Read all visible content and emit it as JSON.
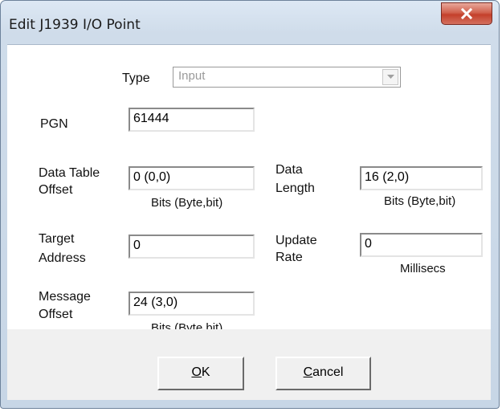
{
  "window": {
    "title": "Edit J1939 I/O Point"
  },
  "icons": {
    "close": "close-icon",
    "dropdown": "chevron-down-icon"
  },
  "form": {
    "type_label": "Type",
    "type_value": "Input",
    "pgn_label": "PGN",
    "pgn_value": "61444",
    "data_table_offset_label_1": "Data Table",
    "data_table_offset_label_2": "Offset",
    "data_table_offset_value": "0 (0,0)",
    "data_table_offset_unit": "Bits (Byte,bit)",
    "data_length_label_1": "Data",
    "data_length_label_2": "Length",
    "data_length_value": "16 (2,0)",
    "data_length_unit": "Bits (Byte,bit)",
    "target_address_label_1": "Target",
    "target_address_label_2": "Address",
    "target_address_value": "0",
    "update_rate_label_1": "Update",
    "update_rate_label_2": "Rate",
    "update_rate_value": "0",
    "update_rate_unit": "Millisecs",
    "message_offset_label_1": "Message",
    "message_offset_label_2": "Offset",
    "message_offset_value": "24 (3,0)",
    "message_offset_unit": "Bits (Byte,bit)"
  },
  "buttons": {
    "ok_rest": "K",
    "ok_mnemonic": "O",
    "cancel_rest": "ancel",
    "cancel_mnemonic": "C"
  },
  "colors": {
    "close_button": "#c4402b",
    "frame": "#c7d6e6",
    "client": "#ffffff"
  }
}
